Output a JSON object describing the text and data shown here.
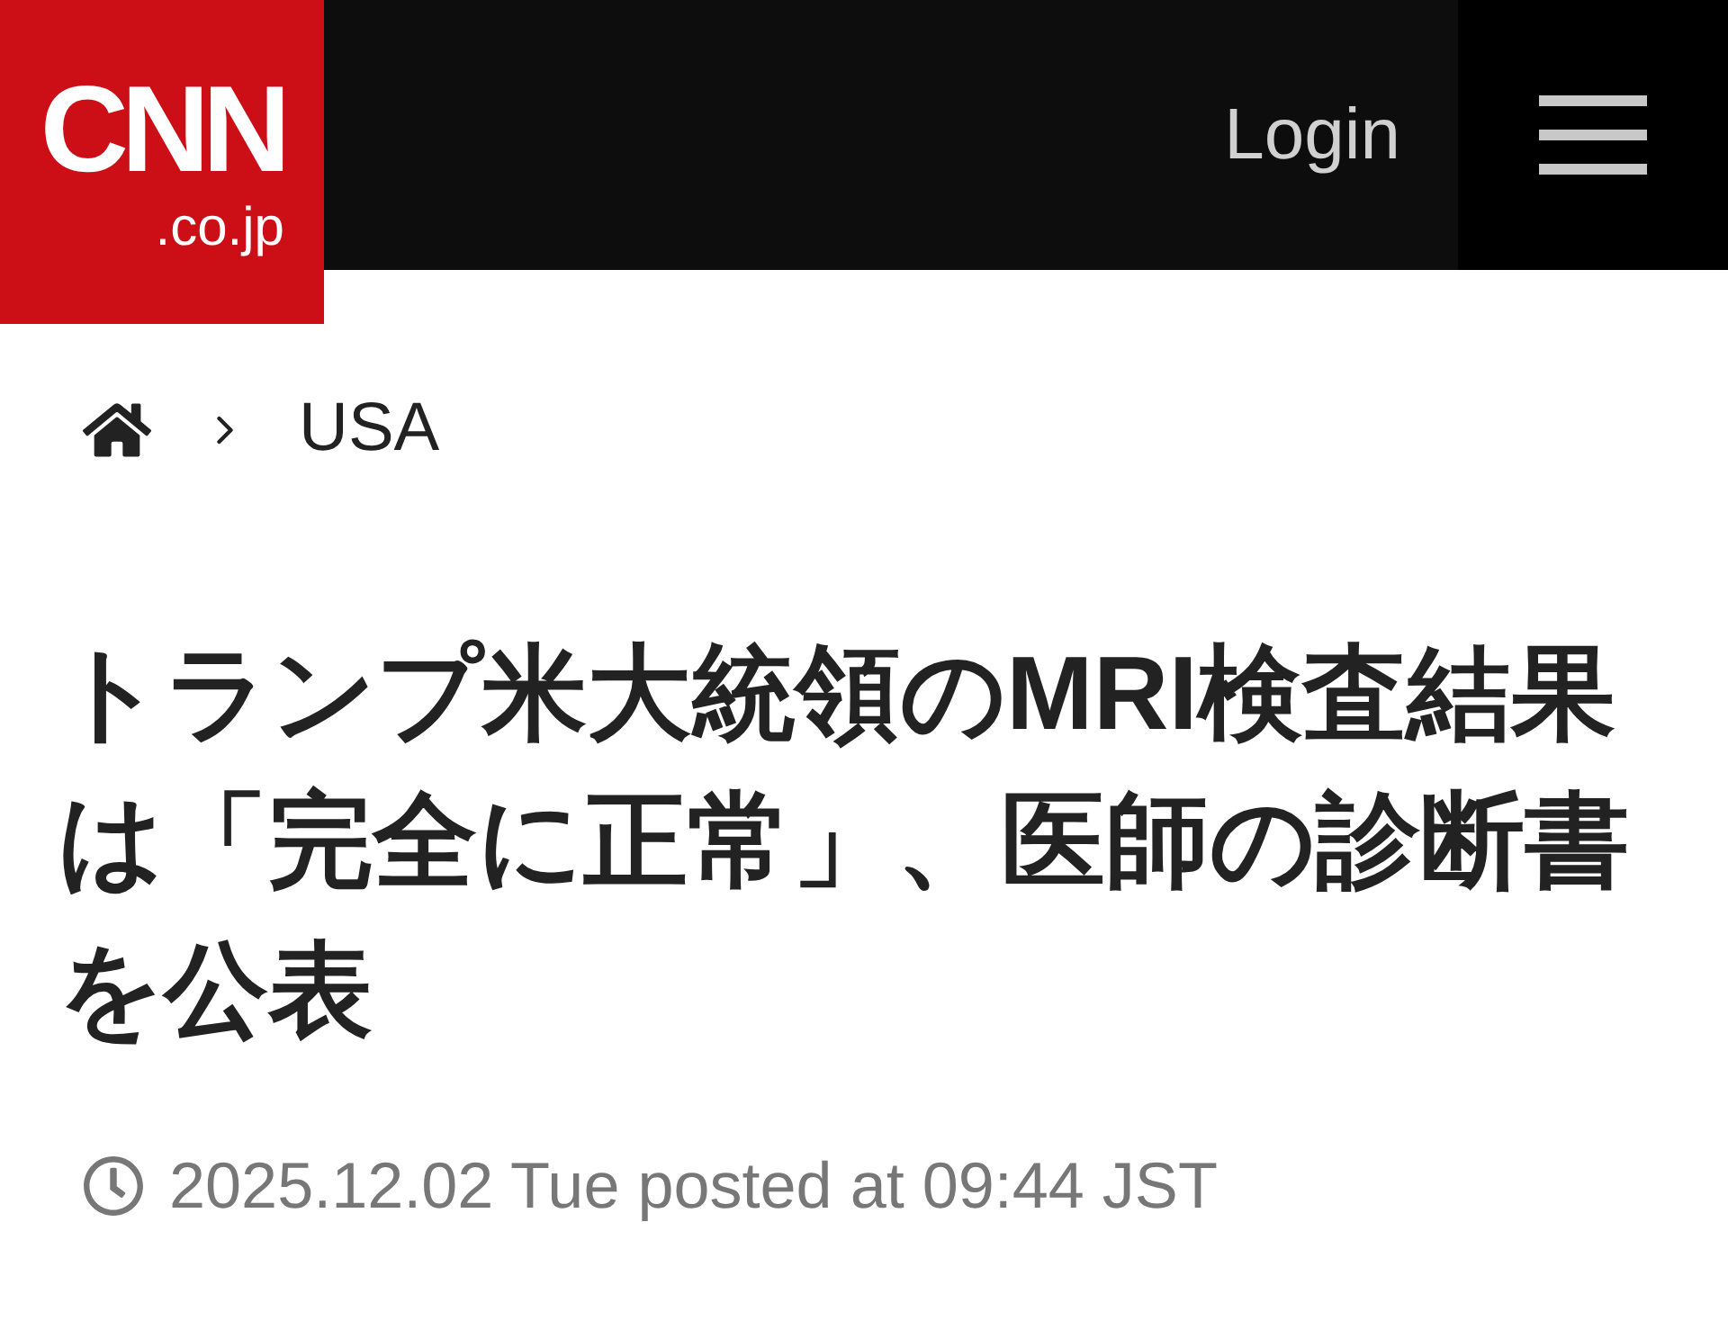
{
  "header": {
    "logo": {
      "main": "CNN",
      "sub": ".co.jp"
    },
    "login": "Login"
  },
  "breadcrumb": {
    "items": [
      "USA"
    ]
  },
  "article": {
    "headline": "トランプ米大統領のMRI検査結果は「完全に正常」、医師の診断書を公表",
    "date": "2025.12.02 Tue posted at 09:44 JST"
  }
}
